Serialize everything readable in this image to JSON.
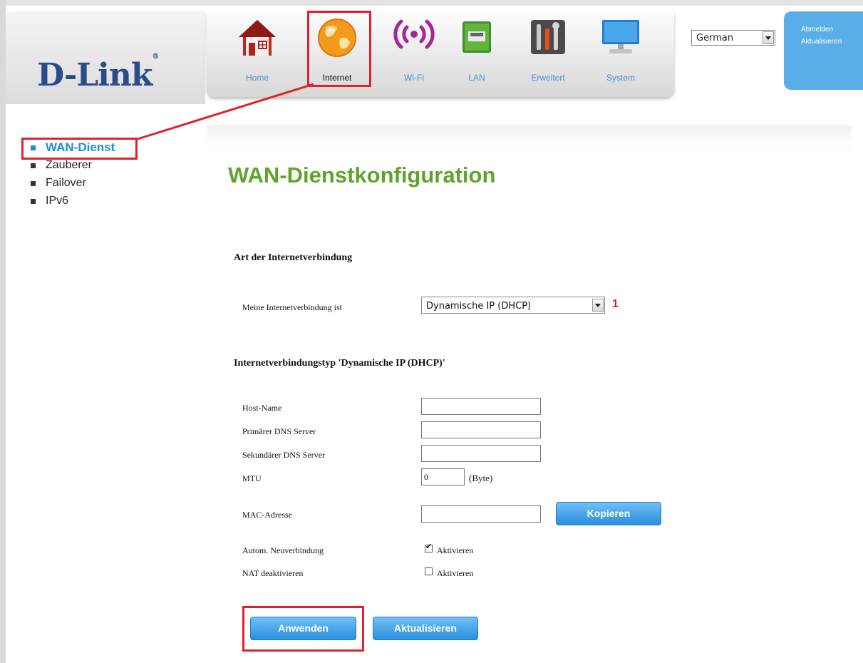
{
  "header": {
    "logo": "D-Link",
    "nav": [
      {
        "label": "Home",
        "icon": "home-icon"
      },
      {
        "label": "Internet",
        "icon": "globe-icon",
        "active": true
      },
      {
        "label": "Wi-Fi",
        "icon": "wifi-icon"
      },
      {
        "label": "LAN",
        "icon": "lan-port-icon"
      },
      {
        "label": "Erweitert",
        "icon": "tools-icon"
      },
      {
        "label": "System",
        "icon": "monitor-icon"
      }
    ],
    "language": "German",
    "links": {
      "logout": "Abmelden",
      "refresh": "Aktualisieren"
    }
  },
  "sidebar": {
    "items": [
      {
        "label": "WAN-Dienst",
        "active": true
      },
      {
        "label": "Zauberer"
      },
      {
        "label": "Failover"
      },
      {
        "label": "IPv6"
      }
    ]
  },
  "main": {
    "title": "WAN-Dienstkonfiguration",
    "section1": "Art der Internetverbindung",
    "connection_label": "Meine Internetverbindung ist",
    "connection_value": "Dynamische IP (DHCP)",
    "marker": "1",
    "section2": "Internetverbindungstyp 'Dynamische IP (DHCP)'",
    "fields": {
      "host_name": {
        "label": "Host-Name",
        "value": ""
      },
      "primary_dns": {
        "label": "Primärer DNS Server",
        "value": ""
      },
      "secondary_dns": {
        "label": "Sekundärer DNS Server",
        "value": ""
      },
      "mtu": {
        "label": "MTU",
        "value": "0",
        "unit": "(Byte)"
      },
      "mac": {
        "label": "MAC-Adresse",
        "value": "",
        "copy_button": "Kopieren"
      }
    },
    "auto_reconnect": {
      "label": "Autom. Neuverbindung",
      "option": "Aktivieren",
      "checked": true
    },
    "disable_nat": {
      "label": "NAT deaktivieren",
      "option": "Aktivieren",
      "checked": false
    },
    "buttons": {
      "apply": "Anwenden",
      "refresh": "Aktualisieren"
    }
  },
  "colors": {
    "accent": "#2a8fdc",
    "title": "#5fa32d",
    "highlight": "#e0202a",
    "side_active": "#1a8fd8"
  }
}
